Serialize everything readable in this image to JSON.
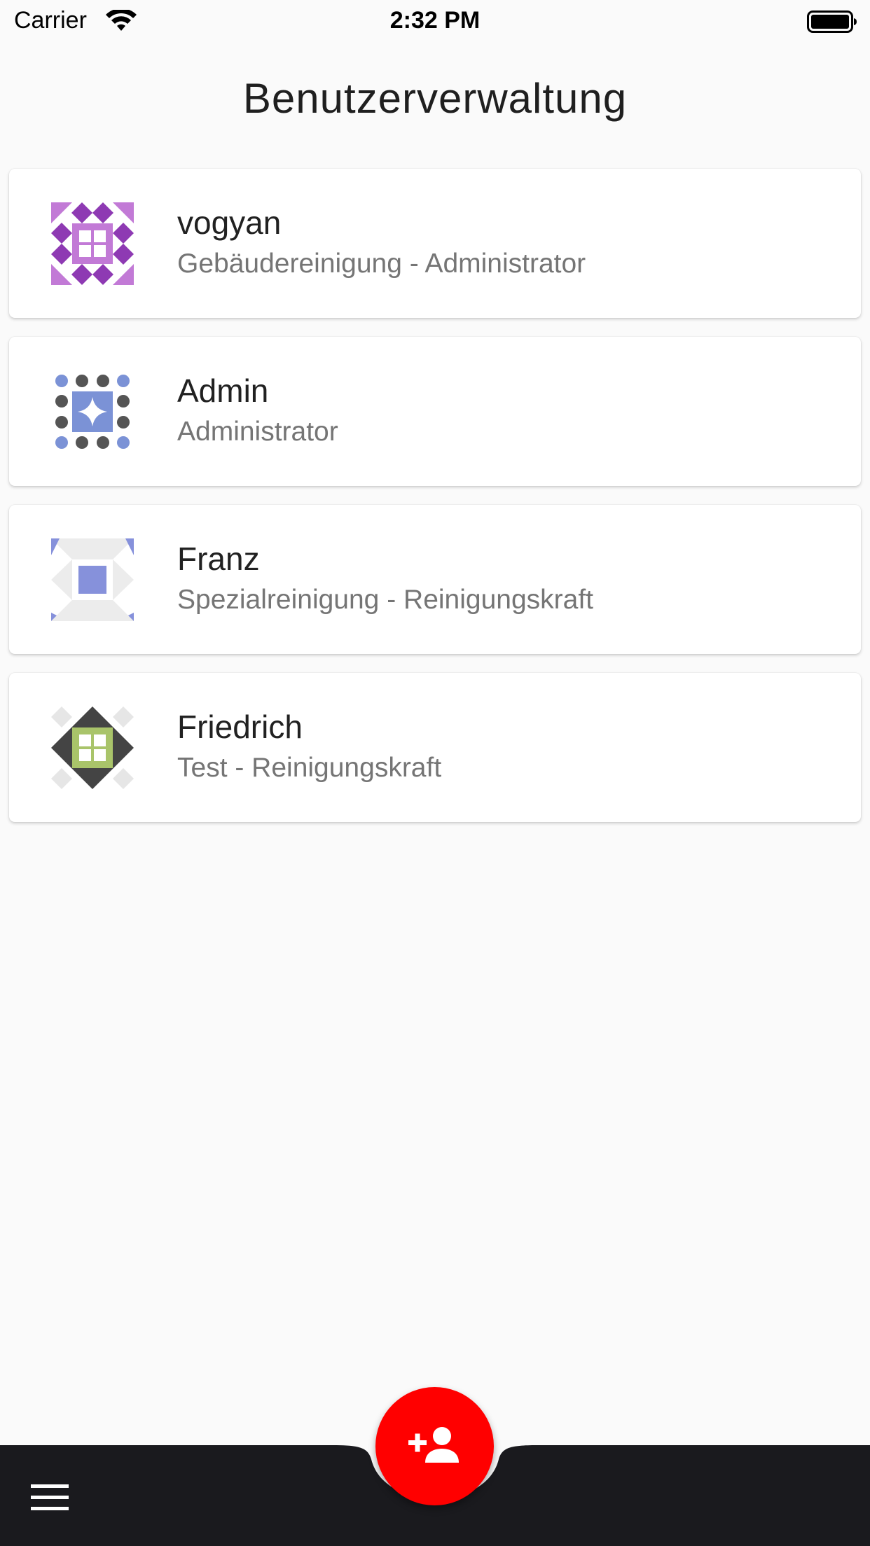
{
  "status_bar": {
    "carrier": "Carrier",
    "time": "2:32 PM",
    "wifi_icon": "wifi-icon",
    "battery_icon": "battery-icon"
  },
  "header": {
    "title": "Benutzerverwaltung"
  },
  "users": [
    {
      "name": "vogyan",
      "role": "Gebäudereinigung - Administrator",
      "avatar_icon": "identicon-avatar",
      "avatar_color": "#8e3ab3"
    },
    {
      "name": "Admin",
      "role": "Administrator",
      "avatar_icon": "identicon-avatar",
      "avatar_color": "#7b92d6"
    },
    {
      "name": "Franz",
      "role": "Spezialreinigung - Reinigungskraft",
      "avatar_icon": "identicon-avatar",
      "avatar_color": "#8691db"
    },
    {
      "name": "Friedrich",
      "role": "Test - Reinigungskraft",
      "avatar_icon": "identicon-avatar",
      "avatar_color": "#a9c46a"
    }
  ],
  "bottom_bar": {
    "menu_icon": "hamburger-menu-icon",
    "fab_icon": "add-person-icon",
    "fab_color": "#ff0000",
    "bar_color": "#1a1a1e"
  }
}
